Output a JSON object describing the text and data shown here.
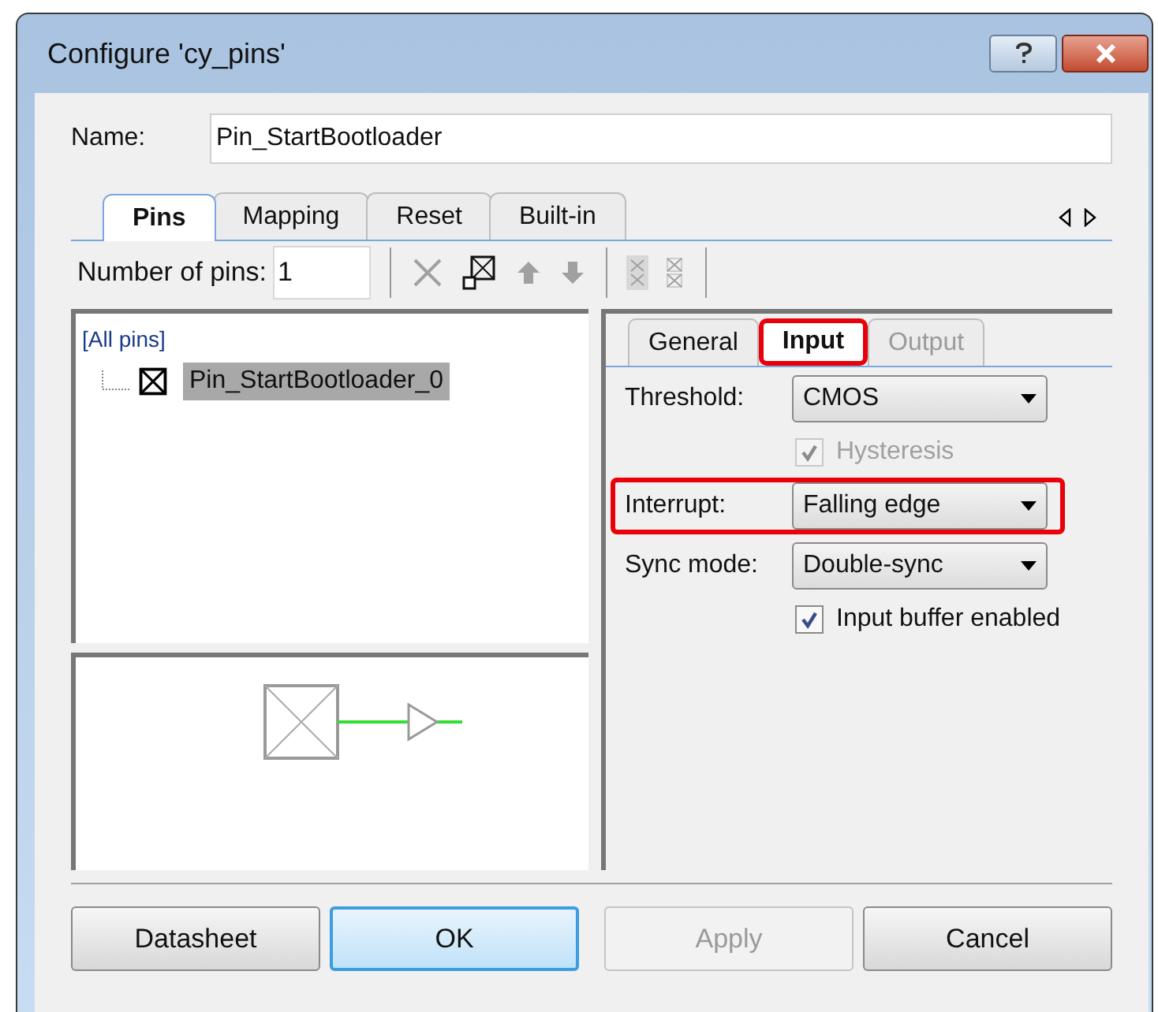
{
  "window": {
    "title": "Configure 'cy_pins'"
  },
  "name_field": {
    "label": "Name:",
    "value": "Pin_StartBootloader"
  },
  "tabs": [
    {
      "label": "Pins",
      "selected": true
    },
    {
      "label": "Mapping",
      "selected": false
    },
    {
      "label": "Reset",
      "selected": false
    },
    {
      "label": "Built-in",
      "selected": false
    }
  ],
  "toolbar": {
    "pins_label": "Number of pins:",
    "pins_value": "1",
    "tools": [
      {
        "kind": "delete",
        "disabled": true
      },
      {
        "kind": "swap",
        "disabled": false
      },
      {
        "kind": "up",
        "disabled": true
      },
      {
        "kind": "down",
        "disabled": true
      },
      {
        "kind": "group",
        "disabled": true
      },
      {
        "kind": "ungroup",
        "disabled": true
      }
    ]
  },
  "pin_tree": {
    "root": "[All pins]",
    "children": [
      {
        "label": "Pin_StartBootloader_0",
        "selected": true
      }
    ]
  },
  "sub_tabs": [
    {
      "label": "General",
      "selected": false,
      "highlighted": false,
      "disabled": false
    },
    {
      "label": "Input",
      "selected": true,
      "highlighted": true,
      "disabled": false
    },
    {
      "label": "Output",
      "selected": false,
      "highlighted": false,
      "disabled": true
    }
  ],
  "input_settings": [
    {
      "kind": "dropdown",
      "label": "Threshold:",
      "value": "CMOS",
      "highlighted": false
    },
    {
      "kind": "checkbox",
      "label": "Hysteresis",
      "checked": true,
      "disabled": true
    },
    {
      "kind": "dropdown",
      "label": "Interrupt:",
      "value": "Falling edge",
      "highlighted": true
    },
    {
      "kind": "dropdown",
      "label": "Sync mode:",
      "value": "Double-sync",
      "highlighted": false
    },
    {
      "kind": "checkbox",
      "label": "Input buffer enabled",
      "checked": true,
      "disabled": false
    }
  ],
  "buttons": [
    {
      "label": "Datasheet",
      "default": false,
      "disabled": false
    },
    {
      "label": "OK",
      "default": true,
      "disabled": false
    },
    {
      "label": "Apply",
      "default": false,
      "disabled": true
    },
    {
      "label": "Cancel",
      "default": false,
      "disabled": false
    }
  ]
}
